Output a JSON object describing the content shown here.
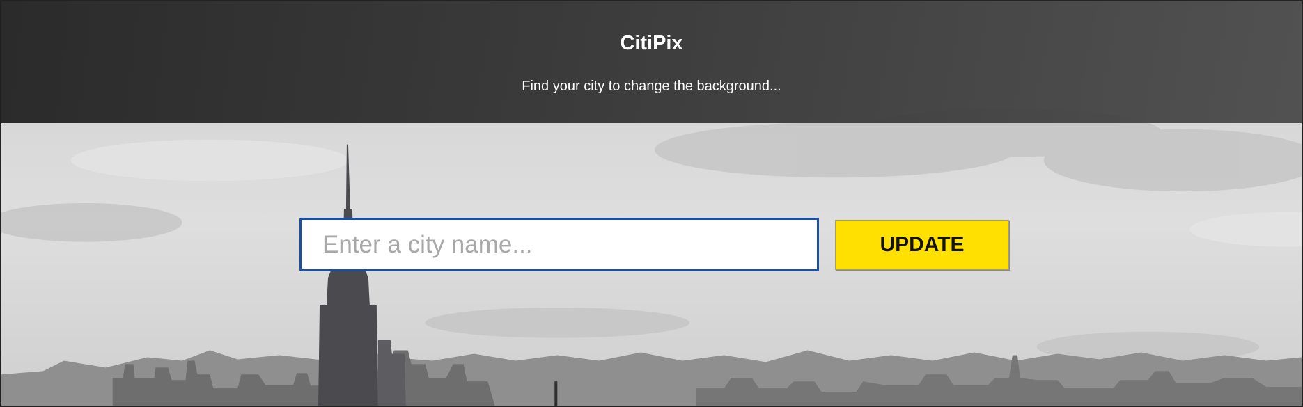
{
  "header": {
    "title": "CitiPix",
    "subtitle": "Find your city to change the background..."
  },
  "search": {
    "placeholder": "Enter a city name...",
    "value": ""
  },
  "update_button": {
    "label": "UPDATE"
  },
  "background": {
    "description_icon": "city-skyline-image",
    "button_color": "#ffe000",
    "input_border_color": "#1a4fa3"
  }
}
